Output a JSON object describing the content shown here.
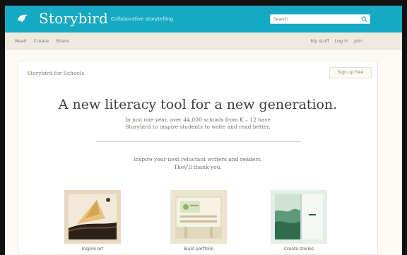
{
  "header": {
    "brand": "Storybird",
    "tagline": "Collaborative storytelling",
    "search_placeholder": "Search"
  },
  "subnav": {
    "left": [
      "Read",
      "Create",
      "Share"
    ],
    "right": [
      "My stuff",
      "Log in",
      "Join"
    ]
  },
  "content": {
    "section_title": "Storybird for Schools",
    "signup_button": "Sign up free",
    "headline": "A new literacy tool for a new generation.",
    "subtext_lines": [
      "In just one year, over 44,000 schools from K – 12 have",
      "Storybird to inspire students to write and read better."
    ],
    "inspire_lines": [
      "Inspire your next reluctant writers and readers.",
      "They'll thank you."
    ],
    "cards": [
      {
        "label": "Inspire art"
      },
      {
        "label": "Build portfolio"
      },
      {
        "label": "Create stories"
      }
    ]
  },
  "colors": {
    "header": "#16a9c2",
    "subnav": "#eeeae0",
    "page_background": "#fbfaf5"
  },
  "icons": [
    "storybird-logo-icon",
    "search-icon"
  ]
}
